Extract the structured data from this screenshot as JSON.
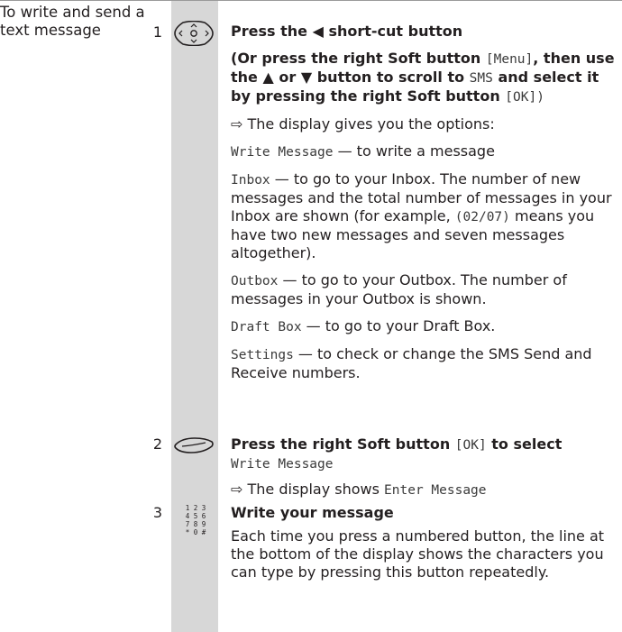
{
  "section_title": "To write and send a text message",
  "steps": [
    {
      "number": "1",
      "icon": "navigation-pad-icon",
      "heading_pre": "Press the",
      "heading_glyph": "◀",
      "heading_post": "short-cut button",
      "alt_1": "(Or press the right Soft button",
      "alt_menu": "[Menu]",
      "alt_2": ", then use the",
      "alt_up": "▲",
      "alt_or": "or",
      "alt_down": "▼",
      "alt_3": "button to scroll to",
      "alt_sms": "SMS",
      "alt_4": "and select it by pressing the right Soft button",
      "alt_ok": "[OK])",
      "display_arrow": "⇨",
      "display_intro": "The display gives you the options:",
      "options": [
        {
          "name": "Write Message",
          "desc": " — to write a message"
        },
        {
          "name": "Inbox",
          "desc": " — to go to your Inbox. The number of new messages and the total number of messages in your Inbox are shown (for example, ",
          "example": "(02/07)",
          "desc_tail": " means you have two new messages and seven messages altogether)."
        },
        {
          "name": "Outbox",
          "desc": " — to go to your Outbox. The number of messages in your Outbox is shown."
        },
        {
          "name": "Draft Box",
          "desc": " —  to go to your Draft Box."
        },
        {
          "name": "Settings",
          "desc": " — to check or change the SMS Send and Receive numbers."
        }
      ]
    },
    {
      "number": "2",
      "icon": "soft-button-icon",
      "heading_pre": "Press the right Soft button",
      "heading_ok": "[OK]",
      "heading_post": "to select",
      "heading_item": "Write Message",
      "display_arrow": "⇨",
      "display_pre": "The display shows",
      "display_value": "Enter Message"
    },
    {
      "number": "3",
      "icon": "keypad-icon",
      "keypad": [
        "1 2 3",
        "4 5 6",
        "7 8 9",
        "* 0 #"
      ],
      "heading": "Write your message",
      "body": "Each time you press a numbered button, the line at the bottom of the display shows the characters you can type by pressing this button repeatedly."
    }
  ]
}
